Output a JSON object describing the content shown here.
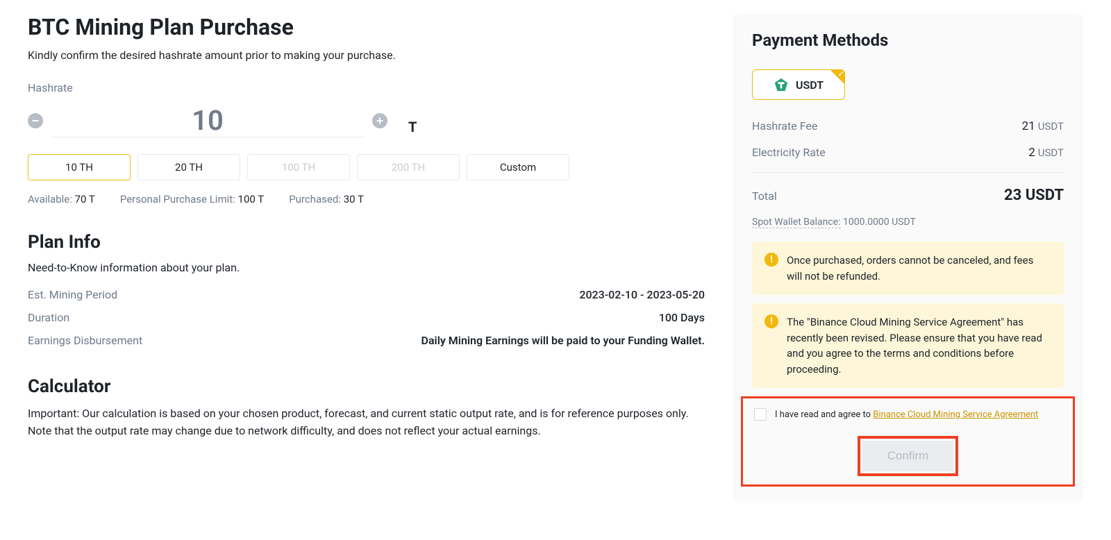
{
  "page": {
    "title": "BTC Mining Plan Purchase",
    "subtitle": "Kindly confirm the desired hashrate amount prior to making your purchase."
  },
  "hashrate": {
    "label": "Hashrate",
    "value": "10",
    "unit": "T",
    "presets": [
      {
        "label": "10 TH",
        "active": true,
        "enabled": true
      },
      {
        "label": "20 TH",
        "active": false,
        "enabled": true
      },
      {
        "label": "100 TH",
        "active": false,
        "enabled": false
      },
      {
        "label": "200 TH",
        "active": false,
        "enabled": false
      },
      {
        "label": "Custom",
        "active": false,
        "enabled": true
      }
    ],
    "limits": {
      "available_label": "Available:",
      "available_value": "70 T",
      "personal_label": "Personal Purchase Limit:",
      "personal_value": "100 T",
      "purchased_label": "Purchased:",
      "purchased_value": "30 T"
    }
  },
  "plan_info": {
    "heading": "Plan Info",
    "description": "Need-to-Know information about your plan.",
    "period_label": "Est. Mining Period",
    "period_value": "2023-02-10 - 2023-05-20",
    "duration_label": "Duration",
    "duration_value": "100 Days",
    "earnings_label": "Earnings Disbursement",
    "earnings_value": "Daily Mining Earnings will be paid to your Funding Wallet."
  },
  "calculator": {
    "heading": "Calculator",
    "description": "Important: Our calculation is based on your chosen product, forecast, and current static output rate, and is for reference purposes only. Note that the output rate may change due to network difficulty, and does not reflect your actual earnings."
  },
  "payment": {
    "heading": "Payment Methods",
    "method": "USDT",
    "hashrate_fee_label": "Hashrate Fee",
    "hashrate_fee_value": "21",
    "electricity_label": "Electricity Rate",
    "electricity_value": "2",
    "currency": "USDT",
    "total_label": "Total",
    "total_value": "23 USDT",
    "wallet_label": "Spot Wallet Balance:",
    "wallet_value": "1000.0000 USDT",
    "notice1": "Once purchased, orders cannot be canceled, and fees will not be refunded.",
    "notice2": "The \"Binance Cloud Mining Service Agreement\" has recently been revised. Please ensure that you have read and you agree to the terms and conditions before proceeding.",
    "agree_prefix": "I have read and agree to ",
    "agree_link": "Binance Cloud Mining Service Agreement",
    "confirm_label": "Confirm"
  }
}
